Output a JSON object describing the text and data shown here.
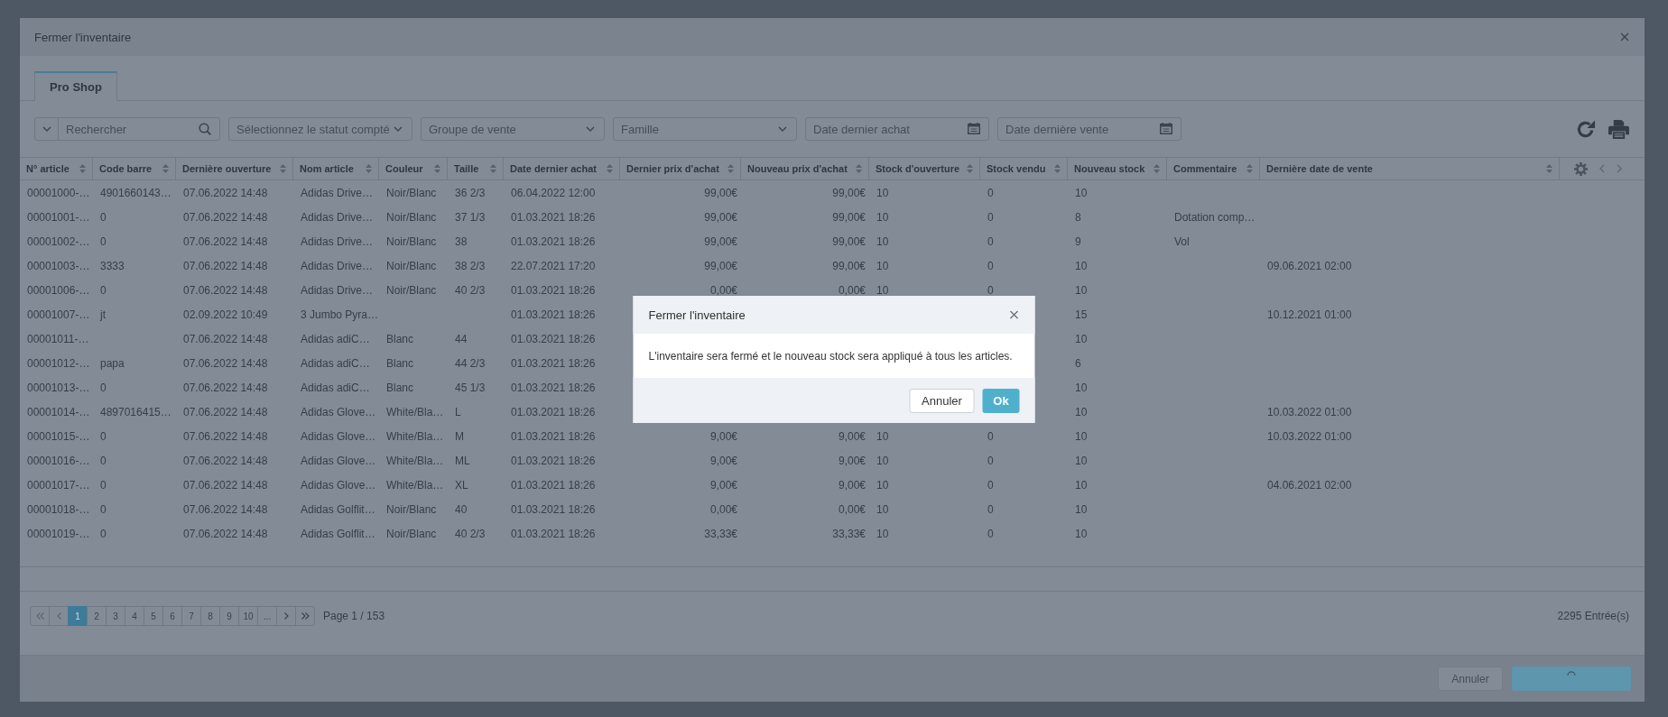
{
  "window": {
    "title": "Fermer l'inventaire"
  },
  "tabs": [
    {
      "label": "Pro Shop",
      "selected": true
    }
  ],
  "toolbar": {
    "search": {
      "placeholder": "Rechercher"
    },
    "filters": [
      {
        "kind": "select",
        "placeholder": "Sélectionnez le statut compté"
      },
      {
        "kind": "select",
        "placeholder": "Groupe de vente"
      },
      {
        "kind": "select",
        "placeholder": "Famille"
      },
      {
        "kind": "date",
        "placeholder": "Date dernier achat"
      },
      {
        "kind": "date",
        "placeholder": "Date dernière vente"
      }
    ]
  },
  "table": {
    "columns": [
      {
        "label": "N° article",
        "kind": "text"
      },
      {
        "label": "Code barre",
        "kind": "text"
      },
      {
        "label": "Dernière ouverture",
        "kind": "text"
      },
      {
        "label": "Nom article",
        "kind": "text"
      },
      {
        "label": "Couleur",
        "kind": "text"
      },
      {
        "label": "Taille",
        "kind": "text"
      },
      {
        "label": "Date dernier achat",
        "kind": "text"
      },
      {
        "label": "Dernier prix d'achat",
        "kind": "money"
      },
      {
        "label": "Nouveau prix d'achat",
        "kind": "money"
      },
      {
        "label": "Stock d'ouverture",
        "kind": "text"
      },
      {
        "label": "Stock vendu",
        "kind": "text"
      },
      {
        "label": "Nouveau stock",
        "kind": "text"
      },
      {
        "label": "Commentaire",
        "kind": "text"
      },
      {
        "label": "Dernière date de vente",
        "kind": "text"
      }
    ],
    "rows": [
      [
        "00001000-…",
        "4901660143…",
        "07.06.2022 14:48",
        "Adidas Drive…",
        "Noir/Blanc",
        "36 2/3",
        "06.04.2022 12:00",
        "99,00€",
        "99,00€",
        "10",
        "0",
        "10",
        null,
        null
      ],
      [
        "00001001-…",
        "0",
        "07.06.2022 14:48",
        "Adidas Drive…",
        "Noir/Blanc",
        "37 1/3",
        "01.03.2021 18:26",
        "99,00€",
        "99,00€",
        "10",
        "0",
        "8",
        "Dotation comp…",
        null
      ],
      [
        "00001002-…",
        "0",
        "07.06.2022 14:48",
        "Adidas Drive…",
        "Noir/Blanc",
        "38",
        "01.03.2021 18:26",
        "99,00€",
        "99,00€",
        "10",
        "0",
        "9",
        "Vol",
        null
      ],
      [
        "00001003-…",
        "3333",
        "07.06.2022 14:48",
        "Adidas Drive…",
        "Noir/Blanc",
        "38 2/3",
        "22.07.2021 17:20",
        "99,00€",
        "99,00€",
        "10",
        "0",
        "10",
        null,
        "09.06.2021 02:00"
      ],
      [
        "00001006-…",
        "0",
        "07.06.2022 14:48",
        "Adidas Drive…",
        "Noir/Blanc",
        "40 2/3",
        "01.03.2021 18:26",
        "0,00€",
        "0,00€",
        "10",
        "0",
        "10",
        null,
        null
      ],
      [
        "00001007-…",
        "jt",
        "02.09.2022 10:49",
        "3 Jumbo Pyra…",
        null,
        null,
        "01.03.2021 18:26",
        null,
        null,
        null,
        null,
        "15",
        null,
        "10.12.2021 01:00"
      ],
      [
        "00001011-…",
        null,
        "07.06.2022 14:48",
        "Adidas adiC…",
        "Blanc",
        "44",
        "01.03.2021 18:26",
        null,
        null,
        null,
        null,
        "10",
        null,
        null
      ],
      [
        "00001012-…",
        "papa",
        "07.06.2022 14:48",
        "Adidas adiC…",
        "Blanc",
        "44 2/3",
        "01.03.2021 18:26",
        null,
        null,
        null,
        null,
        "6",
        null,
        null
      ],
      [
        "00001013-…",
        "0",
        "07.06.2022 14:48",
        "Adidas adiC…",
        "Blanc",
        "45 1/3",
        "01.03.2021 18:26",
        null,
        null,
        null,
        null,
        "10",
        null,
        null
      ],
      [
        "00001014-…",
        "4897016415…",
        "07.06.2022 14:48",
        "Adidas Glove…",
        "White/Bla…",
        "L",
        "01.03.2021 18:26",
        null,
        null,
        null,
        null,
        "10",
        null,
        "10.03.2022 01:00"
      ],
      [
        "00001015-…",
        "0",
        "07.06.2022 14:48",
        "Adidas Glove…",
        "White/Bla…",
        "M",
        "01.03.2021 18:26",
        "9,00€",
        "9,00€",
        "10",
        "0",
        "10",
        null,
        "10.03.2022 01:00"
      ],
      [
        "00001016-…",
        "0",
        "07.06.2022 14:48",
        "Adidas Glove…",
        "White/Bla…",
        "ML",
        "01.03.2021 18:26",
        "9,00€",
        "9,00€",
        "10",
        "0",
        "10",
        null,
        null
      ],
      [
        "00001017-…",
        "0",
        "07.06.2022 14:48",
        "Adidas Glove…",
        "White/Bla…",
        "XL",
        "01.03.2021 18:26",
        "9,00€",
        "9,00€",
        "10",
        "0",
        "10",
        null,
        "04.06.2021 02:00"
      ],
      [
        "00001018-…",
        "0",
        "07.06.2022 14:48",
        "Adidas Golflit…",
        "Noir/Blanc",
        "40",
        "01.03.2021 18:26",
        "0,00€",
        "0,00€",
        "10",
        "0",
        "10",
        null,
        null
      ],
      [
        "00001019-…",
        "0",
        "07.06.2022 14:48",
        "Adidas Golflit…",
        "Noir/Blanc",
        "40 2/3",
        "01.03.2021 18:26",
        "33,33€",
        "33,33€",
        "10",
        "0",
        "10",
        null,
        null
      ]
    ]
  },
  "pagination": {
    "first": {
      "disabled": true
    },
    "previous": {
      "disabled": true
    },
    "pages": [
      {
        "label": "1",
        "selected": true
      },
      {
        "label": "2",
        "selected": false
      },
      {
        "label": "3",
        "selected": false
      },
      {
        "label": "4",
        "selected": false
      },
      {
        "label": "5",
        "selected": false
      },
      {
        "label": "6",
        "selected": false
      },
      {
        "label": "7",
        "selected": false
      },
      {
        "label": "8",
        "selected": false
      },
      {
        "label": "9",
        "selected": false
      },
      {
        "label": "10",
        "selected": false
      },
      {
        "label": "...",
        "selected": false
      }
    ],
    "next": {
      "disabled": false
    },
    "last": {
      "disabled": false
    },
    "page_info": "Page 1 / 153",
    "total": "2295 Entrée(s)"
  },
  "footer": {
    "buttons": [
      {
        "kind": "secondary",
        "label": "Annuler",
        "disabled": true,
        "loading": false
      },
      {
        "kind": "primary",
        "disabled": true,
        "loading": true
      }
    ]
  },
  "dialog": {
    "title": "Fermer l'inventaire",
    "message": "L'inventaire sera fermé et le nouveau stock sera appliqué à tous les articles.",
    "buttons": [
      {
        "kind": "secondary",
        "label": "Annuler"
      },
      {
        "kind": "primary",
        "label": "Ok"
      }
    ]
  }
}
